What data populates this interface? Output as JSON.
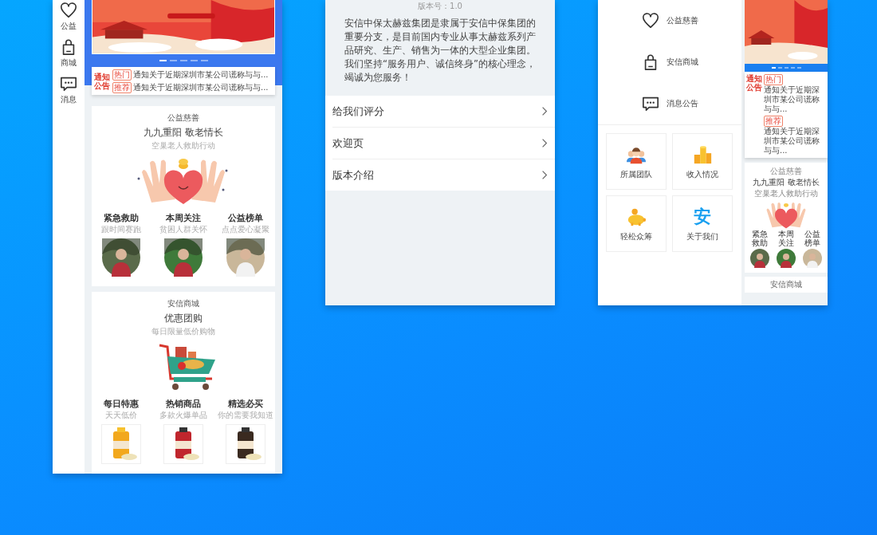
{
  "left_phone": {
    "sidebar": [
      {
        "label": "公益",
        "kind": "heart"
      },
      {
        "label": "商城",
        "kind": "bag"
      },
      {
        "label": "消息",
        "kind": "chat"
      }
    ],
    "banner_dots": [
      {
        "selected": true
      },
      {
        "selected": false
      },
      {
        "selected": false
      },
      {
        "selected": false
      },
      {
        "selected": false
      }
    ],
    "notice": {
      "logo": [
        "通知",
        "公告"
      ],
      "items": [
        {
          "tag": "热门",
          "text": "通知关于近期深圳市某公司谎称与与..."
        },
        {
          "tag": "推荐",
          "text": "通知关于近期深圳市某公司谎称与与..."
        }
      ]
    },
    "charity": {
      "category": "公益慈善",
      "title": "九九重阳 敬老情长",
      "subtitle": "空巢老人救助行动",
      "columns": [
        {
          "title": "紧急救助",
          "subtitle": "跟时间赛跑"
        },
        {
          "title": "本周关注",
          "subtitle": "贫困人群关怀"
        },
        {
          "title": "公益榜单",
          "subtitle": "点点爱心凝聚"
        }
      ]
    },
    "mall": {
      "category": "安信商城",
      "title": "优惠团购",
      "subtitle": "每日限量低价购物",
      "columns": [
        {
          "title": "每日特惠",
          "subtitle": "天天低价"
        },
        {
          "title": "热销商品",
          "subtitle": "多款火爆单品"
        },
        {
          "title": "精选必买",
          "subtitle": "你的需要我知道"
        }
      ]
    }
  },
  "middle_phone": {
    "version": "版本号：1.0",
    "intro": "安信中保太赫兹集团是隶属于安信中保集团的重要分支，是目前国内专业从事太赫兹系列产品研究、生产、销售为一体的大型企业集团。我们坚持“服务用户、诚信终身”的核心理念，竭诚为您服务！",
    "menu": [
      "给我们评分",
      "欢迎页",
      "版本介绍"
    ]
  },
  "right_phone": {
    "menu": [
      {
        "label": "公益慈善",
        "kind": "heart"
      },
      {
        "label": "安信商城",
        "kind": "bag"
      },
      {
        "label": "消息公告",
        "kind": "chat"
      }
    ],
    "tiles": [
      {
        "label": "所属团队",
        "kind": "team"
      },
      {
        "label": "收入情况",
        "kind": "coins"
      },
      {
        "label": "轻松众筹",
        "kind": "piggy"
      },
      {
        "label": "关于我们",
        "kind": "glyph"
      }
    ],
    "tile_glyph": "安",
    "preview": {
      "dots": [
        {
          "selected": true
        },
        {
          "selected": false
        },
        {
          "selected": false
        },
        {
          "selected": false
        },
        {
          "selected": false
        }
      ],
      "logo": [
        "通知",
        "公告"
      ],
      "notices": [
        {
          "tag": "热门",
          "text": "通知关于近期深圳市某公司谎称与与..."
        },
        {
          "tag": "推荐",
          "text": "通知关于近期深圳市某公司谎称与与..."
        }
      ],
      "category": "公益慈善",
      "title": "九九重阳 敬老情长",
      "subtitle": "空巢老人救助行动",
      "columns": [
        "紧急救助",
        "本周关注",
        "公益榜单"
      ],
      "next_category": "安信商城"
    }
  }
}
